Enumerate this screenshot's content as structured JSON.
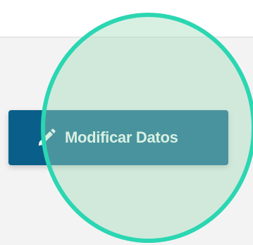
{
  "toolbar": {
    "edit_button_label": "Modificar Datos",
    "edit_button_icon": "pencil-icon"
  },
  "colors": {
    "button_background": "#0a5f8a",
    "highlight_ring": "#2bd6b2",
    "highlight_fill": "#a2dcb9",
    "panel_background": "#f3f3f3"
  }
}
